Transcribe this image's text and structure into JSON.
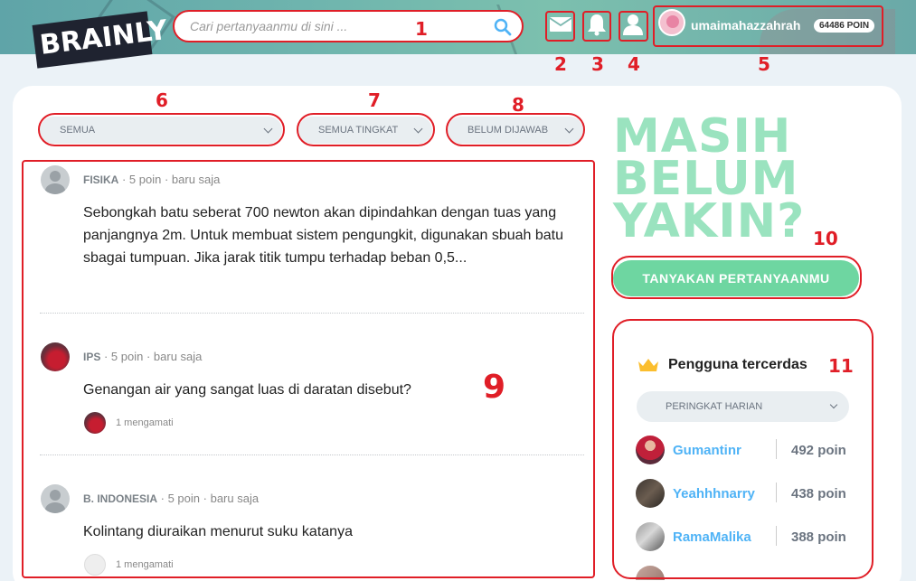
{
  "header": {
    "logo": "BRAINLY",
    "search_placeholder": "Cari pertanyaanmu di sini ...",
    "username": "umaimahazzahrah",
    "points_badge": "64486 POIN"
  },
  "filters": {
    "subject": "SEMUA",
    "level": "SEMUA TINGKAT",
    "status": "BELUM DIJAWAB"
  },
  "questions": [
    {
      "subject": "FISIKA",
      "points": "5 poin",
      "time": "baru saja",
      "text": "Sebongkah batu seberat 700 newton akan dipindahkan dengan tuas yang panjangnya 2m. Untuk membuat sistem pengungkit, digunakan sbuah batu sbagai tumpuan. Jika jarak titik tumpu terhadap beban 0,5...",
      "watchers": ""
    },
    {
      "subject": "IPS",
      "points": "5 poin",
      "time": "baru saja",
      "text": "Genangan air yang sangat luas di daratan disebut?",
      "watchers": "1 mengamati"
    },
    {
      "subject": "B. INDONESIA",
      "points": "5 poin",
      "time": "baru saja",
      "text": "Kolintang diuraikan menurut suku katanya",
      "watchers": "1 mengamati"
    }
  ],
  "sidebar": {
    "headline_line1": "MASIH",
    "headline_line2": "BELUM",
    "headline_line3": "YAKIN?",
    "ask_button": "TANYAKAN PERTANYAANMU",
    "leaderboard_title": "Pengguna tercerdas",
    "leaderboard_filter": "PERINGKAT HARIAN",
    "ranks": [
      {
        "name": "Gumantinr",
        "points": "492 poin"
      },
      {
        "name": "Yeahhhnarry",
        "points": "438 poin"
      },
      {
        "name": "RamaMalika",
        "points": "388 poin"
      }
    ]
  },
  "annotations": [
    "1",
    "2",
    "3",
    "4",
    "5",
    "6",
    "7",
    "8",
    "9",
    "10",
    "11"
  ],
  "colors": {
    "accent_green": "#6ed6a1",
    "headline_green": "#9ae3bf",
    "link_blue": "#4fb3f6",
    "annotation_red": "#e01e27"
  }
}
